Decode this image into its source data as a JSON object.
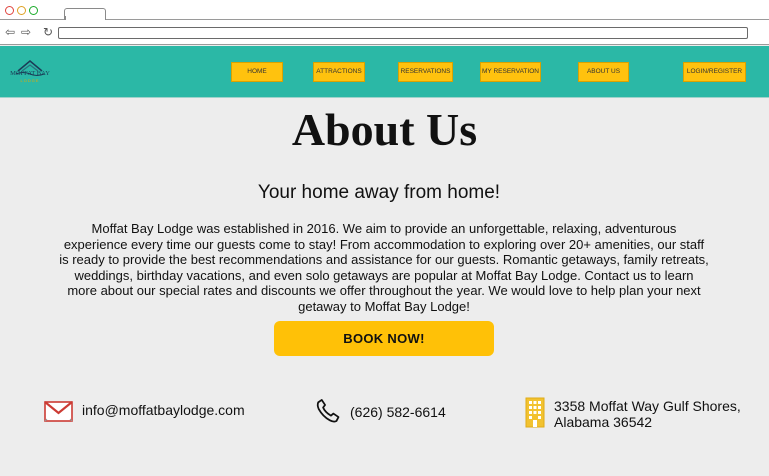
{
  "browser": {
    "back_icon": "arrow-left-icon",
    "forward_icon": "arrow-right-icon",
    "refresh_icon": "refresh-icon",
    "address": ""
  },
  "logo": {
    "name": "MOFFAT BAY",
    "sub": "LODGE"
  },
  "nav": {
    "home": "HOME",
    "attractions": "ATTRACTIONS",
    "reservations": "RESERVATIONS",
    "my_reservation": "MY RESERVATION",
    "about": "ABOUT US",
    "login": "LOGIN/REGISTER"
  },
  "main": {
    "title": "About Us",
    "subtitle": "Your home away from home!",
    "body": "Moffat Bay Lodge was established in 2016. We aim to provide an unforgettable, relaxing, adventurous experience every time our guests come to stay! From accommodation to exploring over 20+ amenities, our staff is ready to provide the best recommendations and assistance for our guests. Romantic getaways, family retreats, weddings, birthday vacations, and even solo getaways are popular at Moffat Bay Lodge. Contact us to learn more about our special rates and discounts we offer throughout the year. We would love to help plan your next getaway to Moffat Bay Lodge!",
    "cta": "BOOK NOW!"
  },
  "contact": {
    "email": "info@moffatbaylodge.com",
    "phone": "(626) 582-6614",
    "address": "3358 Moffat Way Gulf Shores, Alabama 36542",
    "email_icon": "mail-icon",
    "phone_icon": "phone-icon",
    "address_icon": "building-icon"
  },
  "colors": {
    "header": "#2bb8a6",
    "button": "#ffc107",
    "background": "#ededed"
  }
}
